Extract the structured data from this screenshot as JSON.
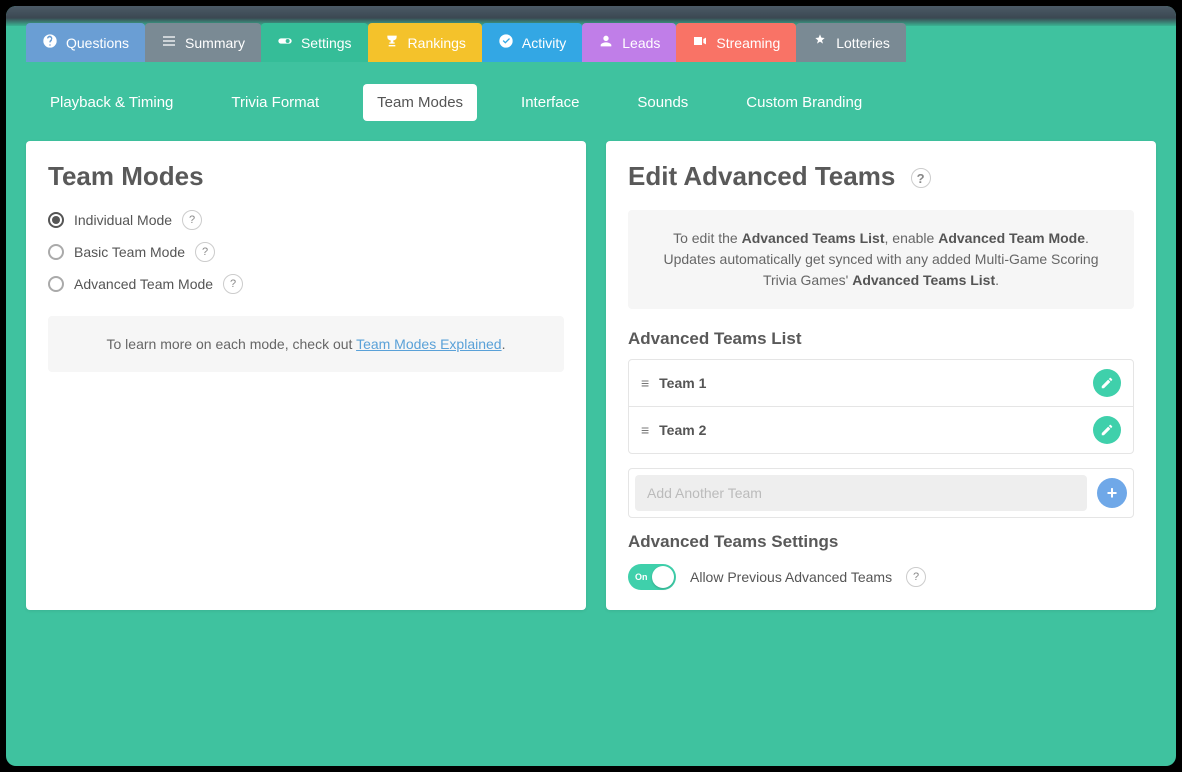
{
  "tabs": {
    "questions": "Questions",
    "summary": "Summary",
    "settings": "Settings",
    "rankings": "Rankings",
    "activity": "Activity",
    "leads": "Leads",
    "streaming": "Streaming",
    "lotteries": "Lotteries"
  },
  "subtabs": {
    "playback": "Playback & Timing",
    "format": "Trivia Format",
    "team": "Team Modes",
    "interface": "Interface",
    "sounds": "Sounds",
    "branding": "Custom Branding"
  },
  "left": {
    "title": "Team Modes",
    "modes": {
      "individual": "Individual Mode",
      "basic": "Basic Team Mode",
      "advanced": "Advanced Team Mode"
    },
    "info_prefix": "To learn more on each mode, check out ",
    "info_link": "Team Modes Explained"
  },
  "right": {
    "title": "Edit Advanced Teams",
    "notice": {
      "p1": "To edit the ",
      "b1": "Advanced Teams List",
      "p2": ", enable ",
      "b2": "Advanced Team Mode",
      "p3": ". Updates automatically get synced with any added Multi-Game Scoring Trivia Games' ",
      "b3": "Advanced Teams List",
      "p4": "."
    },
    "list_title": "Advanced Teams List",
    "teams": [
      "Team 1",
      "Team 2"
    ],
    "add_placeholder": "Add Another Team",
    "settings_title": "Advanced Teams Settings",
    "toggle_state": "On",
    "toggle_label": "Allow Previous Advanced Teams"
  }
}
